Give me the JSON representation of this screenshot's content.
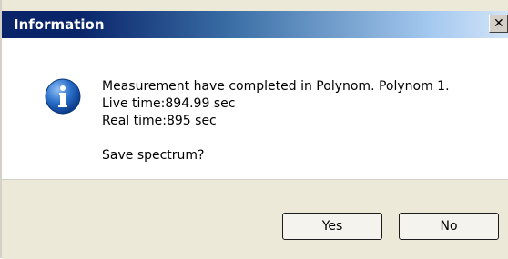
{
  "window": {
    "title": "Information",
    "close_glyph": "✕"
  },
  "icon": {
    "name": "info-icon",
    "color": "#1c5fb8"
  },
  "message": {
    "line1": "Measurement have completed in Polynom. Polynom 1.",
    "line2": "Live time:894.99 sec",
    "line3": "Real time:895 sec",
    "question": "Save spectrum?"
  },
  "buttons": {
    "yes": "Yes",
    "no": "No"
  }
}
